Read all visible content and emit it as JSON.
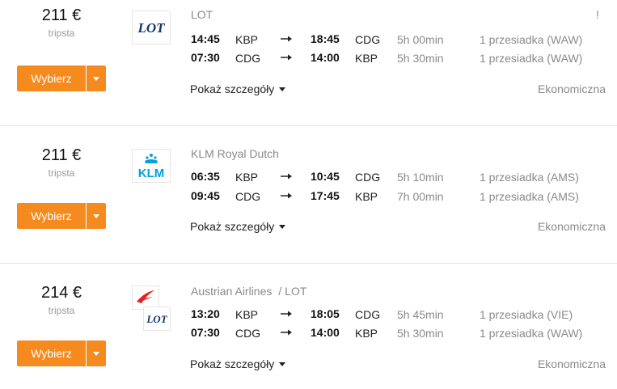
{
  "common": {
    "select_label": "Wybierz",
    "details_label": "Pokaż szczegóły",
    "cabin": "Ekonomiczna",
    "brand_color": "#f58a1f"
  },
  "results": [
    {
      "price": "211 €",
      "provider": "tripsta",
      "airline": "LOT",
      "airline_secondary": "",
      "warning": "!",
      "logos": [
        {
          "icon": "lot-logo-icon",
          "text": "LOT"
        }
      ],
      "legs": [
        {
          "dep_time": "14:45",
          "dep_code": "KBP",
          "arr_time": "18:45",
          "arr_code": "CDG",
          "duration": "5h 00min",
          "stops": "1 przesiadka (WAW)"
        },
        {
          "dep_time": "07:30",
          "dep_code": "CDG",
          "arr_time": "14:00",
          "arr_code": "KBP",
          "duration": "5h 30min",
          "stops": "1 przesiadka (WAW)"
        }
      ]
    },
    {
      "price": "211 €",
      "provider": "tripsta",
      "airline": "KLM Royal Dutch",
      "airline_secondary": "",
      "warning": "",
      "logos": [
        {
          "icon": "klm-logo-icon",
          "text": "KLM"
        }
      ],
      "legs": [
        {
          "dep_time": "06:35",
          "dep_code": "KBP",
          "arr_time": "10:45",
          "arr_code": "CDG",
          "duration": "5h 10min",
          "stops": "1 przesiadka (AMS)"
        },
        {
          "dep_time": "09:45",
          "dep_code": "CDG",
          "arr_time": "17:45",
          "arr_code": "KBP",
          "duration": "7h 00min",
          "stops": "1 przesiadka (AMS)"
        }
      ]
    },
    {
      "price": "214 €",
      "provider": "tripsta",
      "airline": "Austrian Airlines",
      "airline_secondary": "/ LOT",
      "warning": "",
      "logos": [
        {
          "icon": "austrian-logo-icon",
          "text": ""
        },
        {
          "icon": "lot-logo-icon",
          "text": "LOT"
        }
      ],
      "legs": [
        {
          "dep_time": "13:20",
          "dep_code": "KBP",
          "arr_time": "18:05",
          "arr_code": "CDG",
          "duration": "5h 45min",
          "stops": "1 przesiadka (VIE)"
        },
        {
          "dep_time": "07:30",
          "dep_code": "CDG",
          "arr_time": "14:00",
          "arr_code": "KBP",
          "duration": "5h 30min",
          "stops": "1 przesiadka (WAW)"
        }
      ]
    }
  ]
}
